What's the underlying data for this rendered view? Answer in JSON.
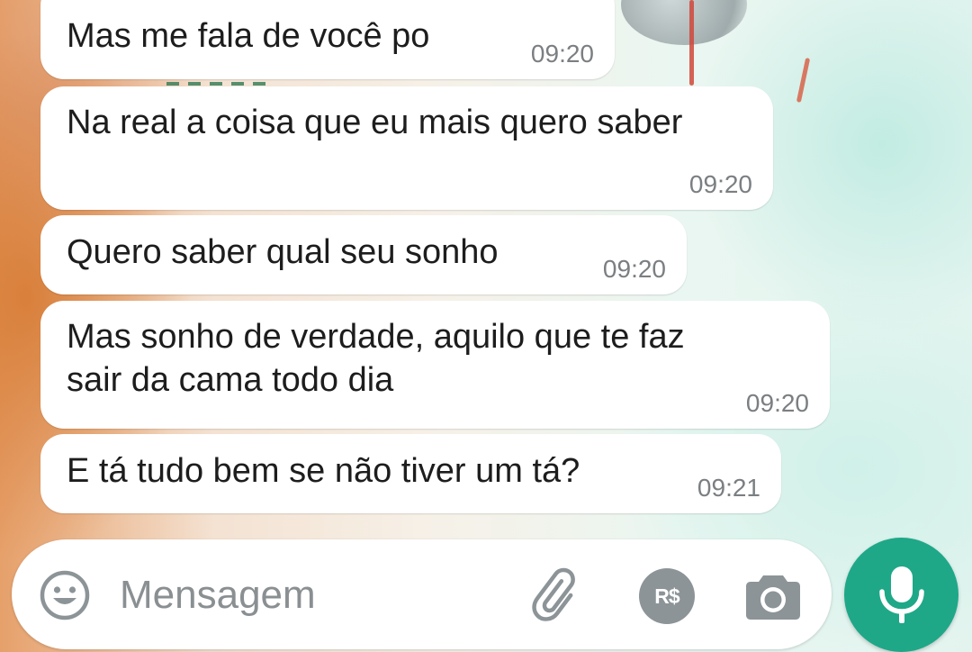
{
  "messages": [
    {
      "text": "Mas me fala de você po",
      "time": "09:20"
    },
    {
      "text": "Na real a coisa que eu mais quero saber",
      "time": "09:20"
    },
    {
      "text": "Quero saber qual seu sonho",
      "time": "09:20"
    },
    {
      "text": "Mas sonho de verdade, aquilo que te faz\nsair da cama todo dia",
      "time": "09:20"
    },
    {
      "text": "E tá tudo bem se não tiver um tá?",
      "time": "09:21"
    }
  ],
  "composer": {
    "placeholder": "Mensagem",
    "payment_label": "R$",
    "icons": {
      "emoji": "emoji-icon",
      "attach": "paperclip-icon",
      "payment": "payment-icon",
      "camera": "camera-icon",
      "mic": "microphone-icon"
    }
  },
  "colors": {
    "bubble": "#ffffff",
    "text": "#1d1d1d",
    "timestamp": "#7b7f82",
    "icon": "#8c9498",
    "mic_button": "#1ea888"
  }
}
